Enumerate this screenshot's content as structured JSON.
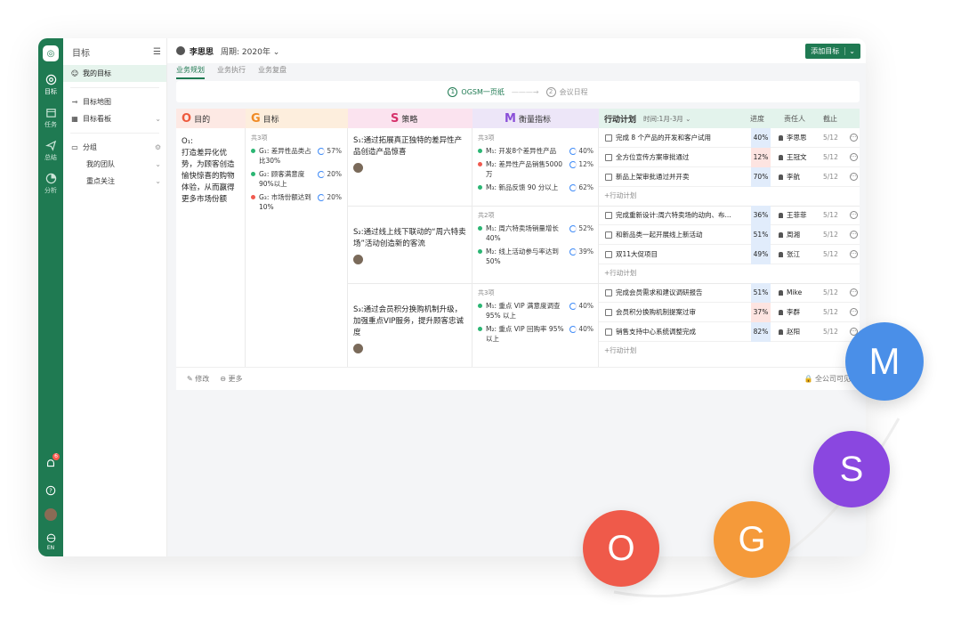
{
  "rail": {
    "items": [
      {
        "label": "目标",
        "icon": "target-icon"
      },
      {
        "label": "任务",
        "icon": "calendar-icon"
      },
      {
        "label": "总结",
        "icon": "send-icon"
      },
      {
        "label": "分析",
        "icon": "pie-icon"
      }
    ],
    "notif_count": "6",
    "lang": "EN"
  },
  "sidebar": {
    "title": "目标",
    "items": [
      {
        "label": "我的目标"
      },
      {
        "label": "目标地图"
      },
      {
        "label": "目标看板"
      },
      {
        "label": "分组"
      },
      {
        "label": "我的团队"
      },
      {
        "label": "重点关注"
      }
    ]
  },
  "topbar": {
    "user": "李思思",
    "period": "周期: 2020年",
    "add_label": "添加目标"
  },
  "tabs": [
    "业务规划",
    "业务执行",
    "业务复盘"
  ],
  "steps": [
    {
      "num": "1",
      "label": "OGSM一页纸"
    },
    {
      "num": "2",
      "label": "会议日程"
    }
  ],
  "columns": {
    "o": {
      "letter": "O",
      "label": "目的",
      "bg": "#fde9e4",
      "color": "#ee5a3d"
    },
    "g": {
      "letter": "G",
      "label": "目标",
      "bg": "#fdeedd",
      "color": "#f08a24"
    },
    "s": {
      "letter": "S",
      "label": "策略",
      "bg": "#fbe3ef",
      "color": "#d6336c"
    },
    "m": {
      "letter": "M",
      "label": "衡量指标",
      "bg": "#ede6f8",
      "color": "#8a4fd8"
    },
    "a": {
      "label": "行动计划",
      "period": "时间:1月-3月",
      "progress": "进度",
      "owner": "责任人",
      "deadline": "截止",
      "bg": "#e3f3ec"
    }
  },
  "objective": {
    "code": "O₁:",
    "text": "打造差异化优势，为顾客创造愉快惊喜的购物体验，从而赢得更多市场份额"
  },
  "goals": {
    "count": "共3项",
    "items": [
      {
        "code": "G₁",
        "text": "差异性品类占比30%",
        "pct": "57%",
        "color": "#2bb673"
      },
      {
        "code": "G₂",
        "text": "顾客满意度90%以上",
        "pct": "20%",
        "color": "#2bb673"
      },
      {
        "code": "G₃",
        "text": "市场份额达到10%",
        "pct": "20%",
        "color": "#f05a4f"
      }
    ]
  },
  "strategies": [
    {
      "code": "S₁:",
      "text": "通过拓展真正独特的差异性产品创造产品惊喜",
      "m_count": "共3项",
      "metrics": [
        {
          "code": "M₁",
          "text": "开发8个差异性产品",
          "pct": "40%",
          "color": "#2bb673"
        },
        {
          "code": "M₂",
          "text": "差异性产品销售5000万",
          "pct": "12%",
          "color": "#f05a4f"
        },
        {
          "code": "M₃",
          "text": "新品反馈 90 分以上",
          "pct": "62%",
          "color": "#2bb673"
        }
      ],
      "actions": [
        {
          "title": "完成 8 个产品的开发和客户试用",
          "progress": "40%",
          "owner": "李思思",
          "deadline": "5/12",
          "pbg": "#e1ecfb"
        },
        {
          "title": "全方位宣传方案审批通过",
          "progress": "12%",
          "owner": "王冠文",
          "deadline": "5/12",
          "pbg": "#fde4e1"
        },
        {
          "title": "新品上架审批通过并开卖",
          "progress": "70%",
          "owner": "李航",
          "deadline": "5/12",
          "pbg": "#e1ecfb"
        }
      ],
      "add_plan": "+行动计划"
    },
    {
      "code": "S₂:",
      "text": "通过线上线下联动的“周六特卖场”活动创造新的客流",
      "m_count": "共2项",
      "metrics": [
        {
          "code": "M₁",
          "text": "周六特卖场销量增长40%",
          "pct": "52%",
          "color": "#2bb673"
        },
        {
          "code": "M₂",
          "text": "线上活动参与率达到50%",
          "pct": "39%",
          "color": "#2bb673"
        }
      ],
      "actions": [
        {
          "title": "完成重新设计:周六特卖场的动向、布...",
          "progress": "36%",
          "owner": "王菲菲",
          "deadline": "5/12",
          "pbg": "#e1ecfb"
        },
        {
          "title": "和新品类一起开展线上新活动",
          "progress": "51%",
          "owner": "周湘",
          "deadline": "5/12",
          "pbg": "#e1ecfb"
        },
        {
          "title": "双11大促项目",
          "progress": "49%",
          "owner": "张江",
          "deadline": "5/12",
          "pbg": "#e1ecfb"
        }
      ],
      "add_plan": "+行动计划"
    },
    {
      "code": "S₃:",
      "text": "通过会员积分换购机制升级，加强重点VIP服务，提升顾客忠诚度",
      "m_count": "共3项",
      "metrics": [
        {
          "code": "M₁",
          "text": "重点 VIP 满意度调查95% 以上",
          "pct": "40%",
          "color": "#2bb673"
        },
        {
          "code": "M₂",
          "text": "重点 VIP 回购率 95% 以上",
          "pct": "40%",
          "color": "#2bb673"
        }
      ],
      "actions": [
        {
          "title": "完成会员需求和建议调研报告",
          "progress": "51%",
          "owner": "Mike",
          "deadline": "5/12",
          "pbg": "#e1ecfb"
        },
        {
          "title": "会员积分换购机制提案过审",
          "progress": "37%",
          "owner": "李群",
          "deadline": "5/12",
          "pbg": "#fde4e1"
        },
        {
          "title": "销售支持中心系统调整完成",
          "progress": "82%",
          "owner": "赵阳",
          "deadline": "5/12",
          "pbg": "#e1ecfb"
        }
      ],
      "add_plan": "+行动计划"
    }
  ],
  "footer": {
    "edit": "修改",
    "more": "更多",
    "visibility": "全公司可见"
  },
  "bubbles": [
    {
      "letter": "O",
      "color": "#ef5a4a"
    },
    {
      "letter": "G",
      "color": "#f59a3a"
    },
    {
      "letter": "S",
      "color": "#8a47e0"
    },
    {
      "letter": "M",
      "color": "#4a8fe8"
    }
  ]
}
